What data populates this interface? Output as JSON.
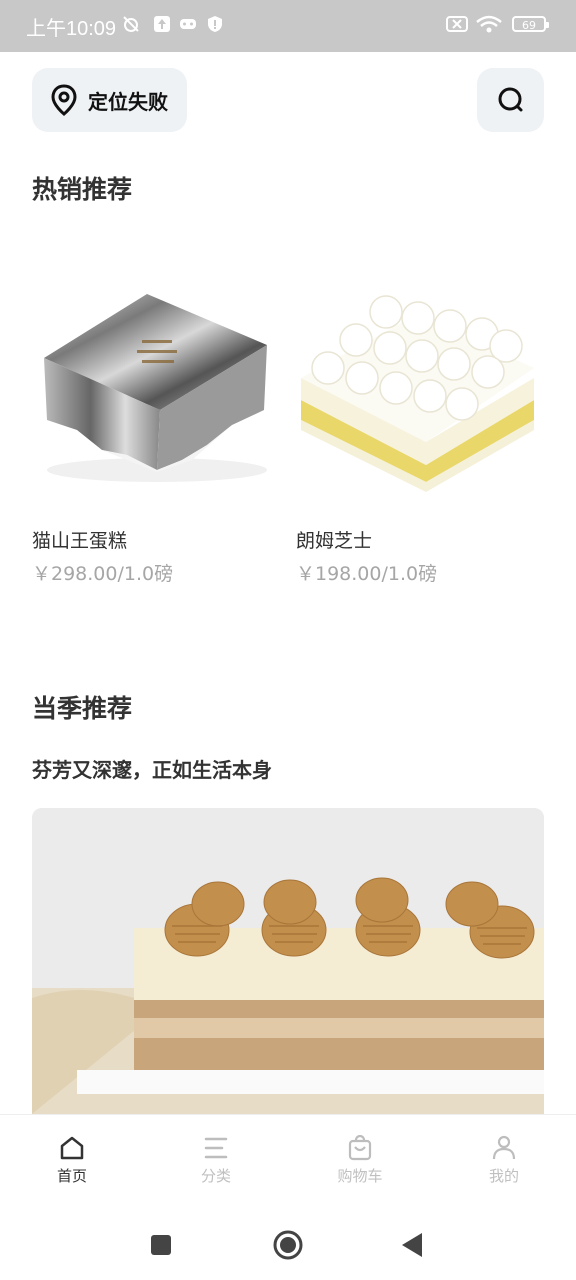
{
  "status_bar": {
    "time": "上午10:09",
    "battery": "69"
  },
  "header": {
    "location_label": "定位失败"
  },
  "hot": {
    "title": "热销推荐",
    "products": [
      {
        "name": "猫山王蛋糕",
        "price": "￥298.00/1.0磅"
      },
      {
        "name": "朗姆芝士",
        "price": "￥198.00/1.0磅"
      }
    ]
  },
  "season": {
    "title": "当季推荐",
    "subtitle": "芬芳又深邃，正如生活本身"
  },
  "tabs": [
    {
      "label": "首页",
      "icon": "home-icon",
      "active": true
    },
    {
      "label": "分类",
      "icon": "list-icon",
      "active": false
    },
    {
      "label": "购物车",
      "icon": "cart-icon",
      "active": false
    },
    {
      "label": "我的",
      "icon": "user-icon",
      "active": false
    }
  ],
  "colors": {
    "accent": "#333333",
    "inactive": "#c0c0c0",
    "chip_bg": "#eef2f5",
    "price": "#a6a6a6"
  }
}
